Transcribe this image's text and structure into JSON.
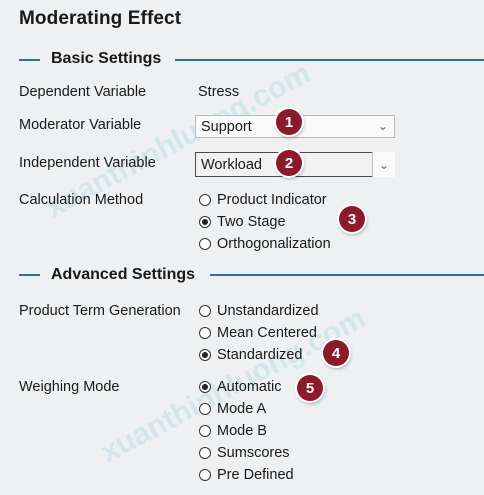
{
  "title": "Moderating Effect",
  "sections": {
    "basic": "Basic Settings",
    "advanced": "Advanced Settings"
  },
  "fields": {
    "dependent": {
      "label": "Dependent Variable",
      "value": "Stress"
    },
    "moderator": {
      "label": "Moderator Variable",
      "value": "Support"
    },
    "independent": {
      "label": "Independent Variable",
      "value": "Workload"
    },
    "calculation": {
      "label": "Calculation Method",
      "options": [
        "Product Indicator",
        "Two Stage",
        "Orthogonalization"
      ],
      "selected": "Two Stage"
    },
    "product_term": {
      "label": "Product Term Generation",
      "options": [
        "Unstandardized",
        "Mean Centered",
        "Standardized"
      ],
      "selected": "Standardized"
    },
    "weighing": {
      "label": "Weighing Mode",
      "options": [
        "Automatic",
        "Mode A",
        "Mode B",
        "Sumscores",
        "Pre Defined"
      ],
      "selected": "Automatic"
    }
  },
  "badges": [
    "1",
    "2",
    "3",
    "4",
    "5"
  ],
  "watermark": [
    "xuanthinhluong.com",
    "xuanthinhluong.com"
  ],
  "icons": {
    "dropdown": "chevron-down-icon"
  },
  "colors": {
    "accent_line": "#2e6fa7",
    "badge": "#8b1a2a",
    "background": "#eef0f2"
  }
}
